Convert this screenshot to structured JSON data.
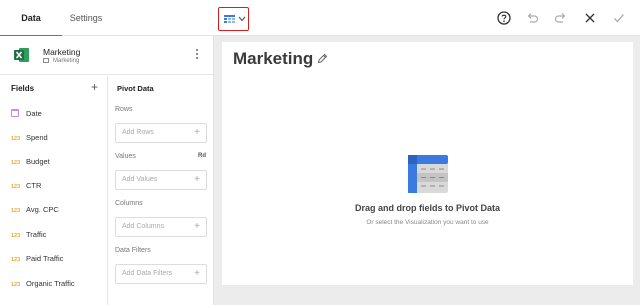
{
  "tabs": [
    {
      "label": "Data",
      "active": true
    },
    {
      "label": "Settings",
      "active": false
    }
  ],
  "toolbar": {
    "viz_picker_icon": "grid-table-icon",
    "viz_picker_dropdown_icon": "chevron-down-icon",
    "help_icon": "help-circle-icon",
    "undo_icon": "undo-icon",
    "redo_icon": "redo-icon",
    "close_icon": "close-icon",
    "confirm_icon": "check-icon",
    "highlight_color": "#d21f1f"
  },
  "datasource": {
    "name": "Marketing",
    "sheet": "Marketing",
    "icon": "excel-icon",
    "menu_icon": "kebab-menu-icon"
  },
  "fields": {
    "title": "Fields",
    "add_symbol": "+",
    "items": [
      {
        "type_label": "",
        "type": "date",
        "name": "Date"
      },
      {
        "type_label": "123",
        "type": "number",
        "name": "Spend"
      },
      {
        "type_label": "123",
        "type": "number",
        "name": "Budget"
      },
      {
        "type_label": "123",
        "type": "number",
        "name": "CTR"
      },
      {
        "type_label": "123",
        "type": "number",
        "name": "Avg. CPC"
      },
      {
        "type_label": "123",
        "type": "number",
        "name": "Traffic"
      },
      {
        "type_label": "123",
        "type": "number",
        "name": "Paid Traffic"
      },
      {
        "type_label": "123",
        "type": "number",
        "name": "Organic Traffic"
      }
    ]
  },
  "pivot": {
    "title": "Pivot Data",
    "rows": {
      "label": "Rows",
      "placeholder": "Add Rows"
    },
    "values": {
      "label": "Values",
      "extra": "Rd",
      "placeholder": "Add Values"
    },
    "columns": {
      "label": "Columns",
      "placeholder": "Add Columns"
    },
    "filters": {
      "label": "Data Filters",
      "placeholder": "Add Data Filters"
    },
    "plus": "+"
  },
  "visualization": {
    "title": "Marketing",
    "edit_icon": "pencil-icon",
    "placeholder_icon": "pivot-table-icon",
    "placeholder_title": "Drag and drop fields to Pivot Data",
    "placeholder_subtitle": "Or select the Visualization you want to use"
  },
  "colors": {
    "accent": "#3b7be0",
    "number_type": "#e8a531",
    "date_type": "#c88ae3",
    "excel_green": "#1e7145"
  }
}
